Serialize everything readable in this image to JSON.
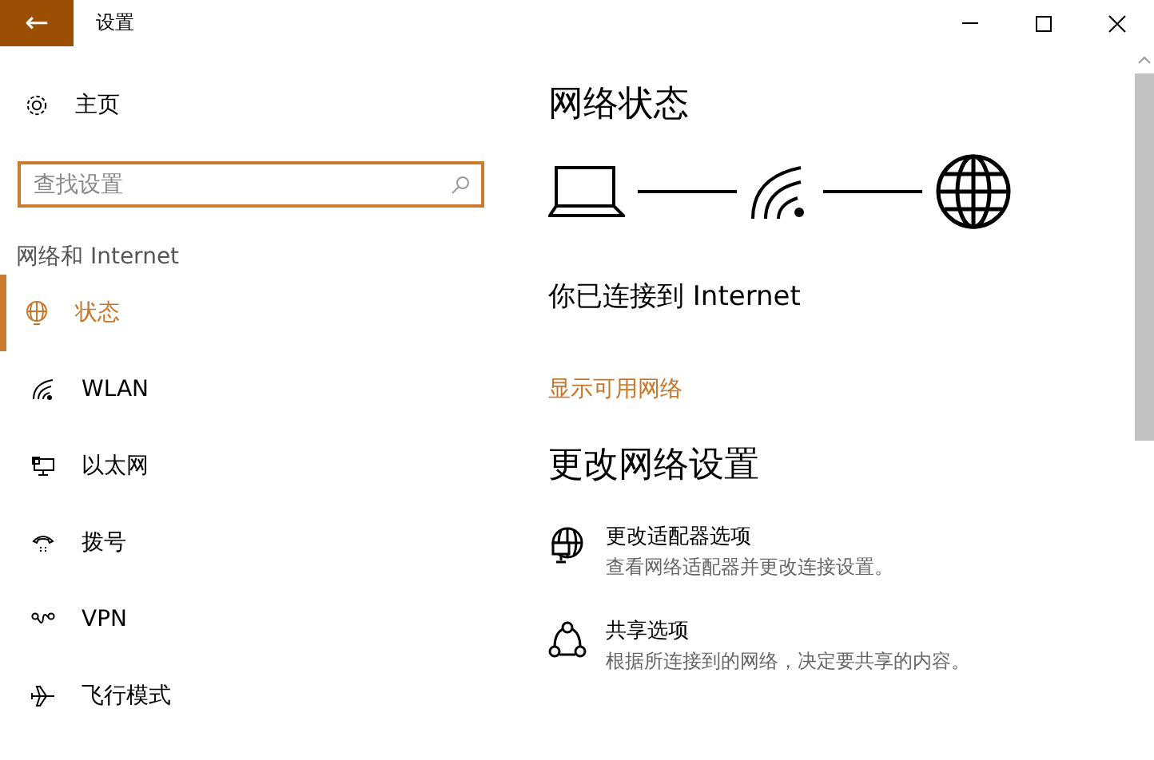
{
  "window": {
    "title": "设置",
    "back": "←"
  },
  "sidebar": {
    "home": "主页",
    "search": {
      "placeholder": "查找设置"
    },
    "section": "网络和 Internet",
    "items": [
      {
        "label": "状态",
        "kind": "status",
        "selected": true
      },
      {
        "label": "WLAN",
        "kind": "wifi",
        "selected": false
      },
      {
        "label": "以太网",
        "kind": "ethernet",
        "selected": false
      },
      {
        "label": "拨号",
        "kind": "dialup",
        "selected": false
      },
      {
        "label": "VPN",
        "kind": "vpn",
        "selected": false
      },
      {
        "label": "飞行模式",
        "kind": "airplane",
        "selected": false
      }
    ]
  },
  "main": {
    "title": "网络状态",
    "status": "你已连接到 Internet",
    "link": "显示可用网络",
    "section_title": "更改网络设置",
    "options": [
      {
        "kind": "adapter",
        "title": "更改适配器选项",
        "description": "查看网络适配器并更改连接设置。"
      },
      {
        "kind": "sharing",
        "title": "共享选项",
        "description": "根据所连接到的网络，决定要共享的内容。"
      }
    ]
  }
}
